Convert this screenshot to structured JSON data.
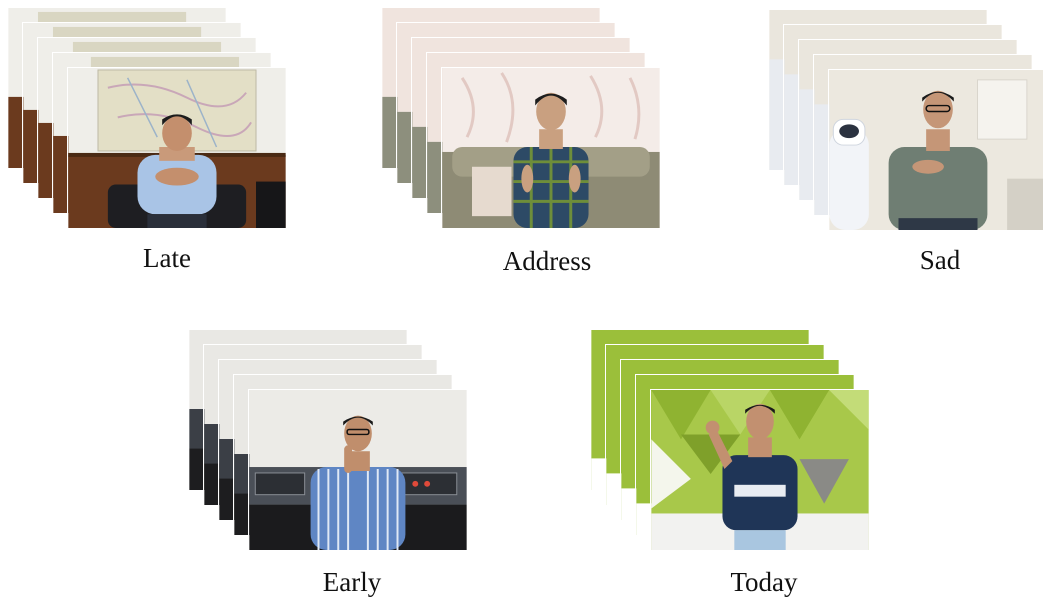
{
  "samples": [
    {
      "label": "Late"
    },
    {
      "label": "Address"
    },
    {
      "label": "Sad"
    },
    {
      "label": "Early"
    },
    {
      "label": "Today"
    }
  ]
}
